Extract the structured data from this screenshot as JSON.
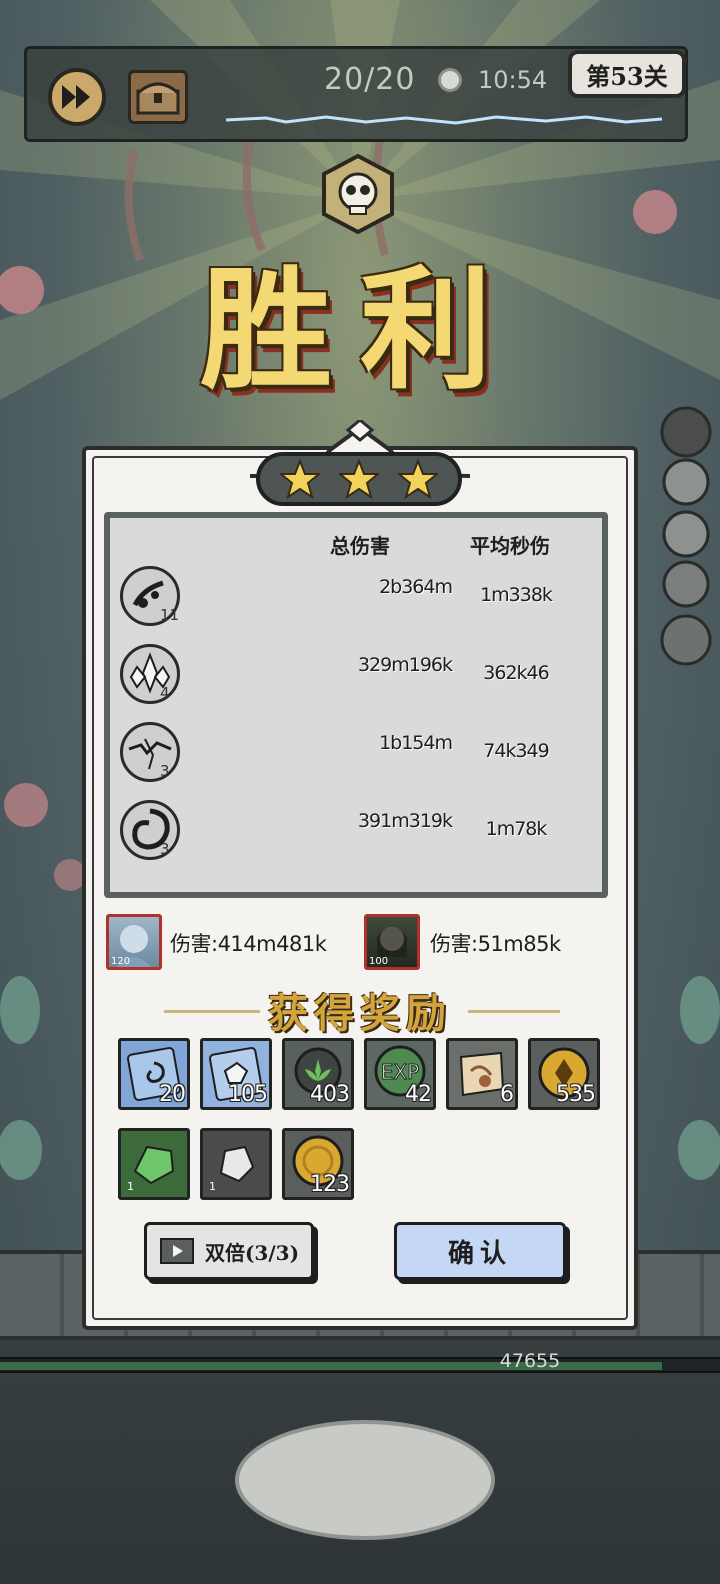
{
  "hud": {
    "wave_counter": "20/20",
    "timer": "10:54",
    "level_label": "第53关",
    "icons": {
      "speed": "fast-forward-icon",
      "chest": "treasure-chest-icon",
      "clock": "clock-icon"
    }
  },
  "title": "胜利",
  "stars": 3,
  "stats": {
    "col_total": "总伤害",
    "col_dps": "平均秒伤",
    "rows": [
      {
        "icon": "shadow-slash-skill-icon",
        "level": "11",
        "total": "2b364m",
        "dps": "1m338k"
      },
      {
        "icon": "ice-crystal-skill-icon",
        "level": "4",
        "total": "329m196k",
        "dps": "362k46"
      },
      {
        "icon": "lightning-skill-icon",
        "level": "3",
        "total": "1b154m",
        "dps": "74k349"
      },
      {
        "icon": "dark-vortex-skill-icon",
        "level": "3",
        "total": "391m319k",
        "dps": "1m78k"
      }
    ]
  },
  "heroes": [
    {
      "level": "120",
      "damage": "伤害:414m481k"
    },
    {
      "level": "100",
      "damage": "伤害:51m85k"
    }
  ],
  "rewards_title": "获得奖励",
  "rewards": [
    {
      "icon": "vortex-scroll-icon",
      "count": "20",
      "color": "#7fa6d6"
    },
    {
      "icon": "crystal-card-icon",
      "count": "105",
      "color": "#8fb2de"
    },
    {
      "icon": "green-leaf-emblem-icon",
      "count": "403",
      "color": "#58615c"
    },
    {
      "icon": "exp-orb-icon",
      "count": "42",
      "color": "#5e6862"
    },
    {
      "icon": "map-scroll-icon",
      "count": "6",
      "color": "#6a6f6c"
    },
    {
      "icon": "gold-gem-coin-icon",
      "count": "535",
      "color": "#5b605e"
    },
    {
      "icon": "green-ore-icon",
      "count": "1",
      "color": "#3c6a3a"
    },
    {
      "icon": "silver-ore-icon",
      "count": "1",
      "color": "#4a4c4b"
    },
    {
      "icon": "gold-coin-icon",
      "count": "123",
      "color": "#5a5e5c"
    }
  ],
  "buttons": {
    "double": "双倍(3/3)",
    "confirm": "确认"
  },
  "boss_hp": "47655",
  "boss_hp_fraction": 0.92
}
